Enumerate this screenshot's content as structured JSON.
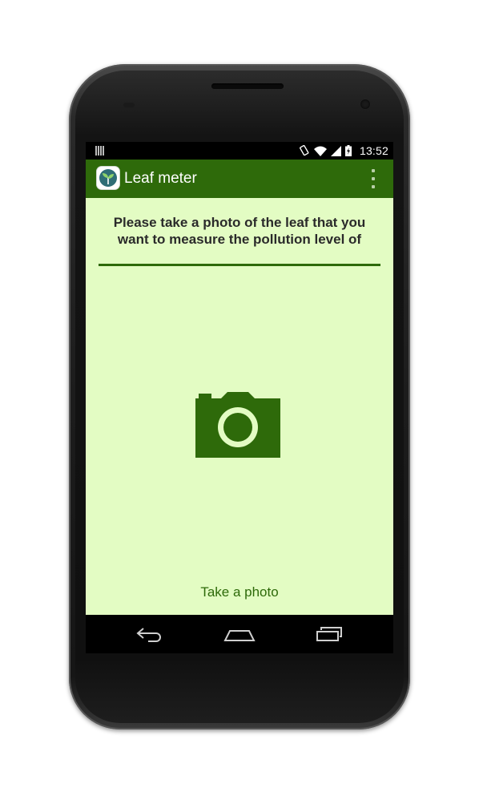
{
  "status_bar": {
    "time": "13:52",
    "icons": [
      "notification-icon",
      "rotation-icon",
      "wifi-icon",
      "signal-icon",
      "battery-charging-icon"
    ]
  },
  "action_bar": {
    "title": "Leaf meter",
    "app_icon": "leaf-app-icon",
    "overflow_icon": "overflow-menu-icon"
  },
  "main": {
    "instruction": "Please take a photo of the leaf that you want to measure the pollution level of",
    "camera_icon": "camera-icon",
    "take_photo_label": "Take a photo"
  },
  "nav_bar": {
    "icons": [
      "back-icon",
      "home-icon",
      "recent-apps-icon"
    ]
  },
  "colors": {
    "primary": "#2e6a0a",
    "background": "#e3fcc3",
    "text": "#2a2a2a"
  }
}
